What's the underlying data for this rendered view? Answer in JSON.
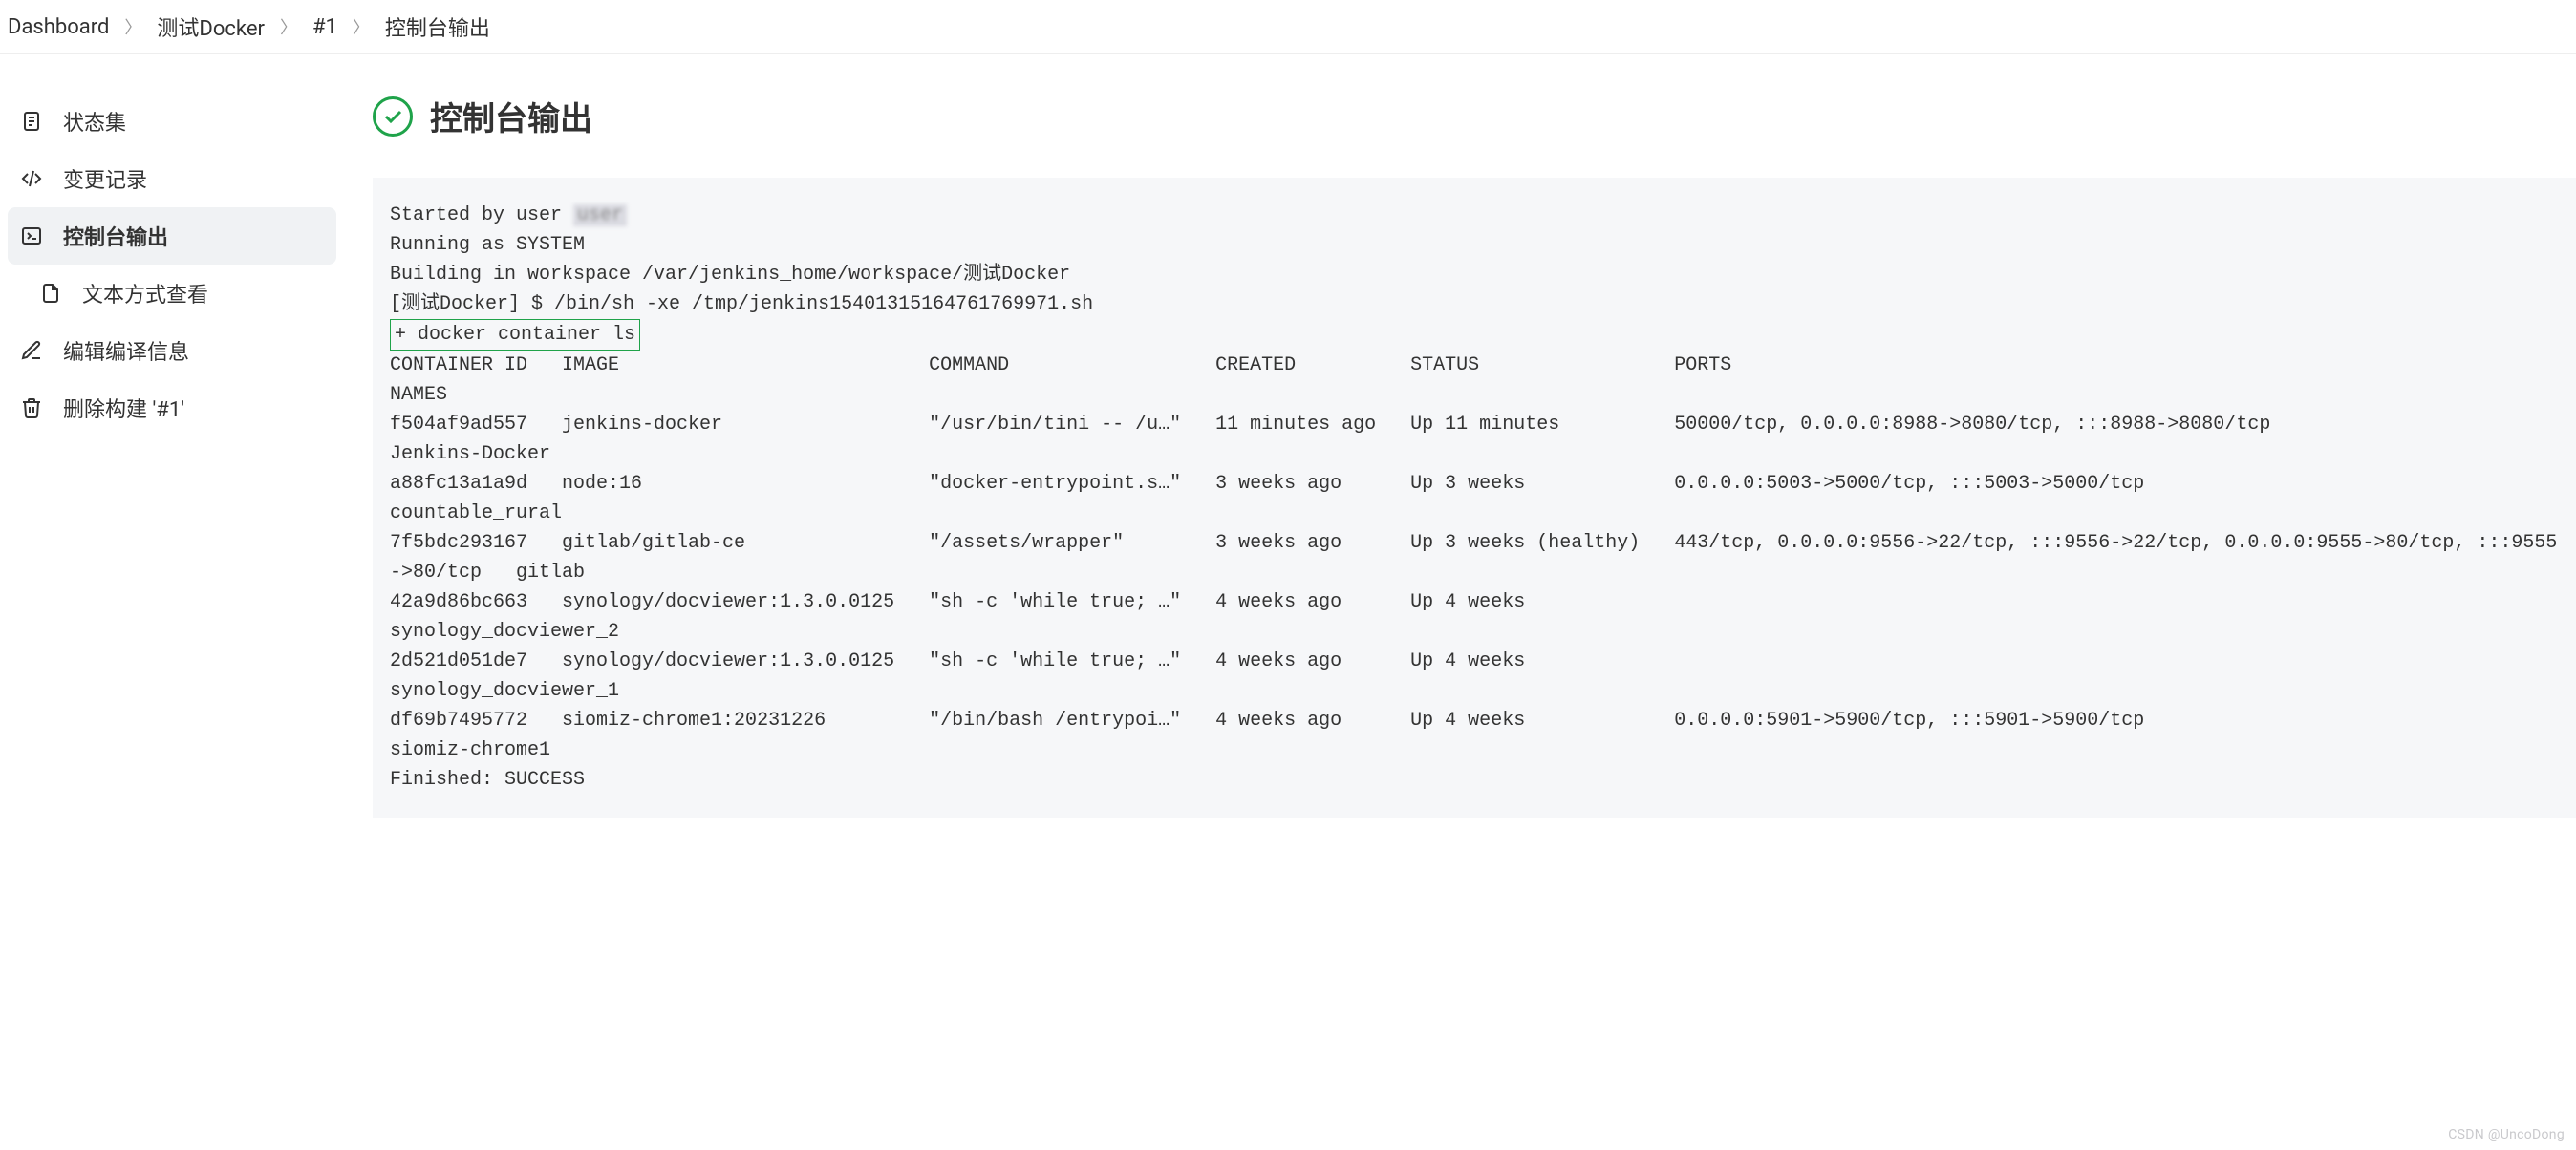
{
  "breadcrumb": [
    {
      "label": "Dashboard"
    },
    {
      "label": "测试Docker"
    },
    {
      "label": "#1"
    },
    {
      "label": "控制台输出"
    }
  ],
  "sidebar": {
    "items": [
      {
        "label": "状态集",
        "icon": "document-icon"
      },
      {
        "label": "变更记录",
        "icon": "code-icon"
      },
      {
        "label": "控制台输出",
        "icon": "terminal-icon",
        "active": true
      },
      {
        "label": "文本方式查看",
        "icon": "file-icon",
        "indent": true
      },
      {
        "label": "编辑编译信息",
        "icon": "edit-icon"
      },
      {
        "label": "删除构建 '#1'",
        "icon": "trash-icon"
      }
    ]
  },
  "page": {
    "title": "控制台输出",
    "status": "success"
  },
  "console": {
    "start_line_prefix": "Started by user ",
    "user_text": "user",
    "line2": "Running as SYSTEM",
    "line3": "Building in workspace /var/jenkins_home/workspace/测试Docker",
    "line4": "[测试Docker] $ /bin/sh -xe /tmp/jenkins15401315164761769971.sh",
    "highlight": "+ docker container ls",
    "header": "CONTAINER ID   IMAGE                           COMMAND                  CREATED          STATUS                 PORTS                                                                                      NAMES",
    "rows": [
      "f504af9ad557   jenkins-docker                  \"/usr/bin/tini -- /u…\"   11 minutes ago   Up 11 minutes          50000/tcp, 0.0.0.0:8988->8080/tcp, :::8988->8080/tcp                                       Jenkins-Docker",
      "a88fc13a1a9d   node:16                         \"docker-entrypoint.s…\"   3 weeks ago      Up 3 weeks             0.0.0.0:5003->5000/tcp, :::5003->5000/tcp                                                  countable_rural",
      "7f5bdc293167   gitlab/gitlab-ce                \"/assets/wrapper\"        3 weeks ago      Up 3 weeks (healthy)   443/tcp, 0.0.0.0:9556->22/tcp, :::9556->22/tcp, 0.0.0.0:9555->80/tcp, :::9555->80/tcp   gitlab",
      "42a9d86bc663   synology/docviewer:1.3.0.0125   \"sh -c 'while true; …\"   4 weeks ago      Up 4 weeks                                                                                                        synology_docviewer_2",
      "2d521d051de7   synology/docviewer:1.3.0.0125   \"sh -c 'while true; …\"   4 weeks ago      Up 4 weeks                                                                                                        synology_docviewer_1",
      "df69b7495772   siomiz-chrome1:20231226         \"/bin/bash /entrypoi…\"   4 weeks ago      Up 4 weeks             0.0.0.0:5901->5900/tcp, :::5901->5900/tcp                                                  siomiz-chrome1"
    ],
    "finish": "Finished: SUCCESS"
  },
  "watermark": "CSDN @UncoDong"
}
